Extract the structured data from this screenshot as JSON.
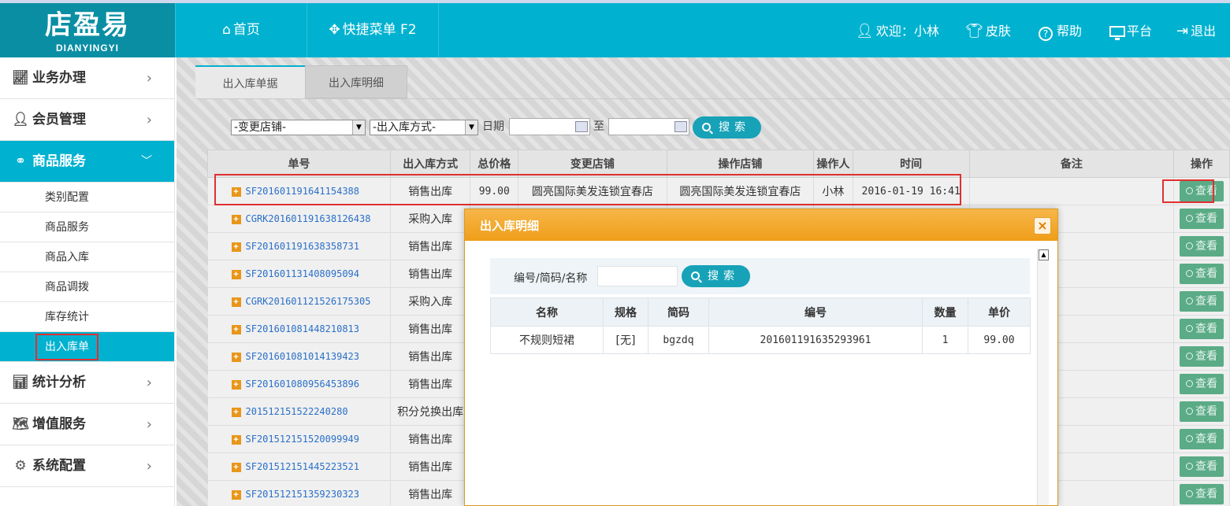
{
  "header": {
    "logo_cn": "店盈易",
    "logo_en": "DIANYINGYI",
    "home_label": "首页",
    "quick_menu_label": "快捷菜单 F2",
    "welcome_label": "欢迎：小林",
    "skin_label": "皮肤",
    "help_label": "帮助",
    "platform_label": "平台",
    "logout_label": "退出"
  },
  "sidebar": {
    "menus": [
      {
        "label": "业务办理",
        "icon": "chart-icon"
      },
      {
        "label": "会员管理",
        "icon": "user-icon"
      },
      {
        "label": "商品服务",
        "icon": "goods-icon"
      },
      {
        "label": "统计分析",
        "icon": "stats-icon"
      },
      {
        "label": "增值服务",
        "icon": "map-icon"
      },
      {
        "label": "系统配置",
        "icon": "gear-icon"
      }
    ],
    "sub_items": [
      "类别配置",
      "商品服务",
      "商品入库",
      "商品调拨",
      "库存统计",
      "出入库单"
    ]
  },
  "tabs": [
    "出入库单据",
    "出入库明细"
  ],
  "filter": {
    "store_select": "-变更店铺-",
    "method_select": "-出入库方式-",
    "date_label": "日期",
    "to_label": "至",
    "search_label": "搜索"
  },
  "table": {
    "headers": [
      "单号",
      "出入库方式",
      "总价格",
      "变更店铺",
      "操作店铺",
      "操作人",
      "时间",
      "备注",
      "操作"
    ],
    "view_label": "查看",
    "first_row": {
      "number": "SF201601191641154388",
      "method": "销售出库",
      "total": "99.00",
      "change_store": "圆亮国际美发连锁宜春店",
      "operate_store": "圆亮国际美发连锁宜春店",
      "operator": "小林",
      "time": "2016-01-19 16:41"
    },
    "rows": [
      {
        "number": "CGRK201601191638126438",
        "method": "采购入库"
      },
      {
        "number": "SF201601191638358731",
        "method": "销售出库"
      },
      {
        "number": "SF201601131408095094",
        "method": "销售出库"
      },
      {
        "number": "CGRK201601121526175305",
        "method": "采购入库"
      },
      {
        "number": "SF201601081448210813",
        "method": "销售出库"
      },
      {
        "number": "SF201601081014139423",
        "method": "销售出库"
      },
      {
        "number": "SF201601080956453896",
        "method": "销售出库"
      },
      {
        "number": "201512151522240280",
        "method": "积分兑换出库"
      },
      {
        "number": "SF201512151520099949",
        "method": "销售出库"
      },
      {
        "number": "SF201512151445223521",
        "method": "销售出库"
      },
      {
        "number": "SF201512151359230323",
        "method": "销售出库"
      }
    ]
  },
  "modal": {
    "title": "出入库明细",
    "close_label": "×",
    "filter_label": "编号/简码/名称",
    "search_label": "搜索",
    "headers": [
      "名称",
      "规格",
      "简码",
      "编号",
      "数量",
      "单价"
    ],
    "rows": [
      {
        "name": "不规则短裙",
        "spec": "[无]",
        "code": "bgzdq",
        "number": "201601191635293961",
        "qty": "1",
        "price": "99.00"
      }
    ]
  },
  "colors": {
    "primary": "#00b2d0",
    "logo_bg": "#0a8ea4",
    "modal_header": "#f0a21f",
    "view_button": "#5aab86",
    "link": "#2a70c8",
    "highlight_box": "#e03030"
  }
}
